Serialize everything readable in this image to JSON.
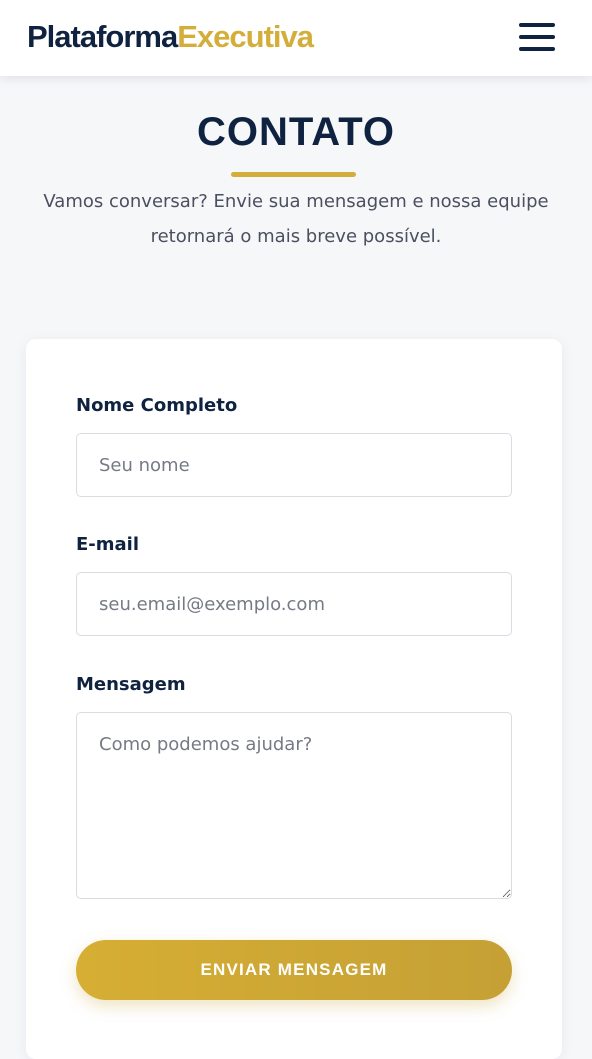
{
  "header": {
    "logo_part1": "Plataforma",
    "logo_part2": "Executiva",
    "menu_icon": "hamburger-menu-icon"
  },
  "section": {
    "title": "CONTATO",
    "subtitle": "Vamos conversar? Envie sua mensagem e nossa equipe retornará o mais breve possível."
  },
  "form": {
    "name_label": "Nome Completo",
    "name_placeholder": "Seu nome",
    "name_value": "",
    "email_label": "E-mail",
    "email_placeholder": "seu.email@exemplo.com",
    "email_value": "",
    "message_label": "Mensagem",
    "message_placeholder": "Como podemos ajudar?",
    "message_value": "",
    "submit_label": "ENVIAR MENSAGEM"
  },
  "colors": {
    "navy": "#0f2240",
    "gold": "#d3ae3a",
    "background": "#f6f7f9"
  }
}
